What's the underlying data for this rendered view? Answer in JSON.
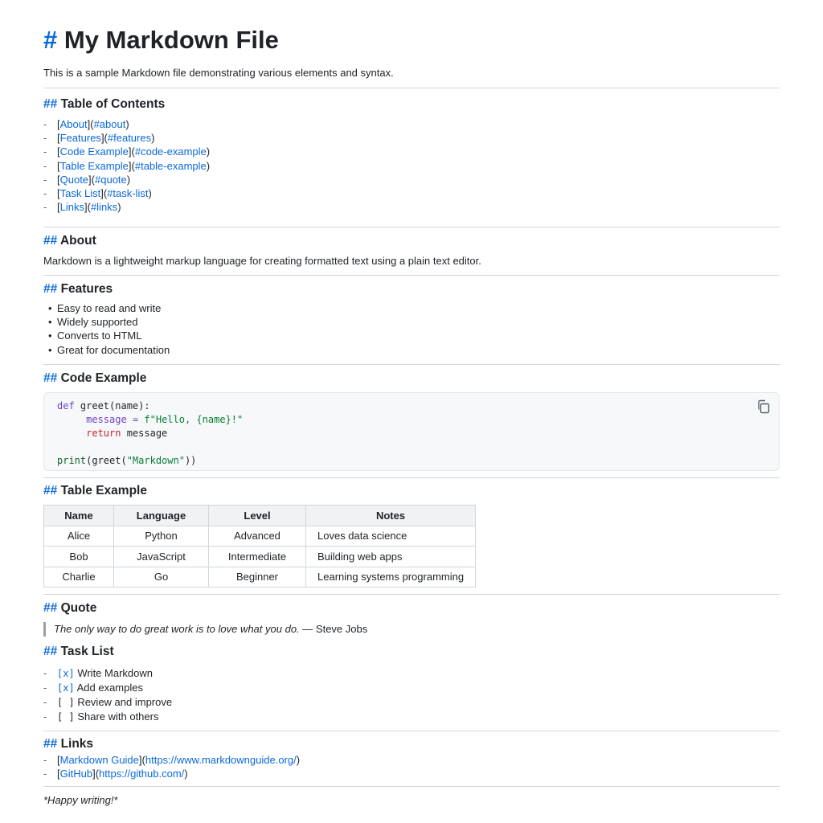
{
  "title": "My Markdown File",
  "intro": "This is a sample Markdown file demonstrating various elements and syntax.",
  "heading_marker_h1": "#",
  "heading_marker_h2": "##",
  "toc": {
    "heading": "Table of Contents",
    "items": [
      {
        "text": "About",
        "anchor": "#about"
      },
      {
        "text": "Features",
        "anchor": "#features"
      },
      {
        "text": "Code Example",
        "anchor": "#code-example"
      },
      {
        "text": "Table Example",
        "anchor": "#table-example"
      },
      {
        "text": "Quote",
        "anchor": "#quote"
      },
      {
        "text": "Task List",
        "anchor": "#task-list"
      },
      {
        "text": "Links",
        "anchor": "#links"
      }
    ]
  },
  "about": {
    "heading": "About",
    "text": "Markdown is a lightweight markup language for creating formatted text using a plain text editor."
  },
  "features": {
    "heading": "Features",
    "items": [
      "Easy to read and write",
      "Widely supported",
      "Converts to HTML",
      "Great for documentation"
    ]
  },
  "code": {
    "heading": "Code Example",
    "copy_icon": "copy-icon"
  },
  "table": {
    "heading": "Table Example",
    "headers": [
      "Name",
      "Language",
      "Level",
      "Notes"
    ],
    "rows": [
      [
        "Alice",
        "Python",
        "Advanced",
        "Loves data science"
      ],
      [
        "Bob",
        "JavaScript",
        "Intermediate",
        "Building web apps"
      ],
      [
        "Charlie",
        "Go",
        "Beginner",
        "Learning systems programming"
      ]
    ]
  },
  "quote": {
    "heading": "Quote",
    "text": "The only way to do great work is to love what you do.",
    "author": "— Steve Jobs"
  },
  "tasks": {
    "heading": "Task List",
    "items": [
      {
        "box": "[x]",
        "text": "Write Markdown"
      },
      {
        "box": "[x]",
        "text": "Add examples"
      },
      {
        "box": "[ ]",
        "text": "Review and improve"
      },
      {
        "box": "[ ]",
        "text": "Share with others"
      }
    ]
  },
  "links": {
    "heading": "Links",
    "items": [
      {
        "text": "Markdown Guide",
        "url": "https://www.markdownguide.org/"
      },
      {
        "text": "GitHub",
        "url": "https://github.com/"
      }
    ]
  },
  "footer": "*Happy writing!*",
  "colors": {
    "accent": "#0969da",
    "code_keyword": "#6f42c1",
    "code_string": "#0a7d34"
  }
}
